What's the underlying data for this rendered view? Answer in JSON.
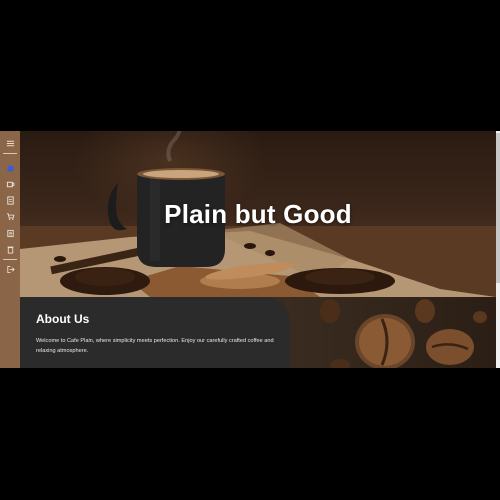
{
  "sidebar": {
    "items": [
      {
        "icon": "menu-icon"
      },
      {
        "icon": "home-icon"
      },
      {
        "icon": "coffee-cup-icon"
      },
      {
        "icon": "document-icon"
      },
      {
        "icon": "cart-icon"
      },
      {
        "icon": "list-icon"
      },
      {
        "icon": "trash-icon"
      },
      {
        "icon": "logout-icon"
      }
    ],
    "accent": "#8a6547",
    "active_color": "#3b5bd9"
  },
  "hero": {
    "title": "Plain but Good"
  },
  "about": {
    "title": "About Us",
    "text": "Welcome to Cafe Plain, where simplicity meets perfection. Enjoy our carefully crafted coffee and relaxing atmosphere."
  }
}
